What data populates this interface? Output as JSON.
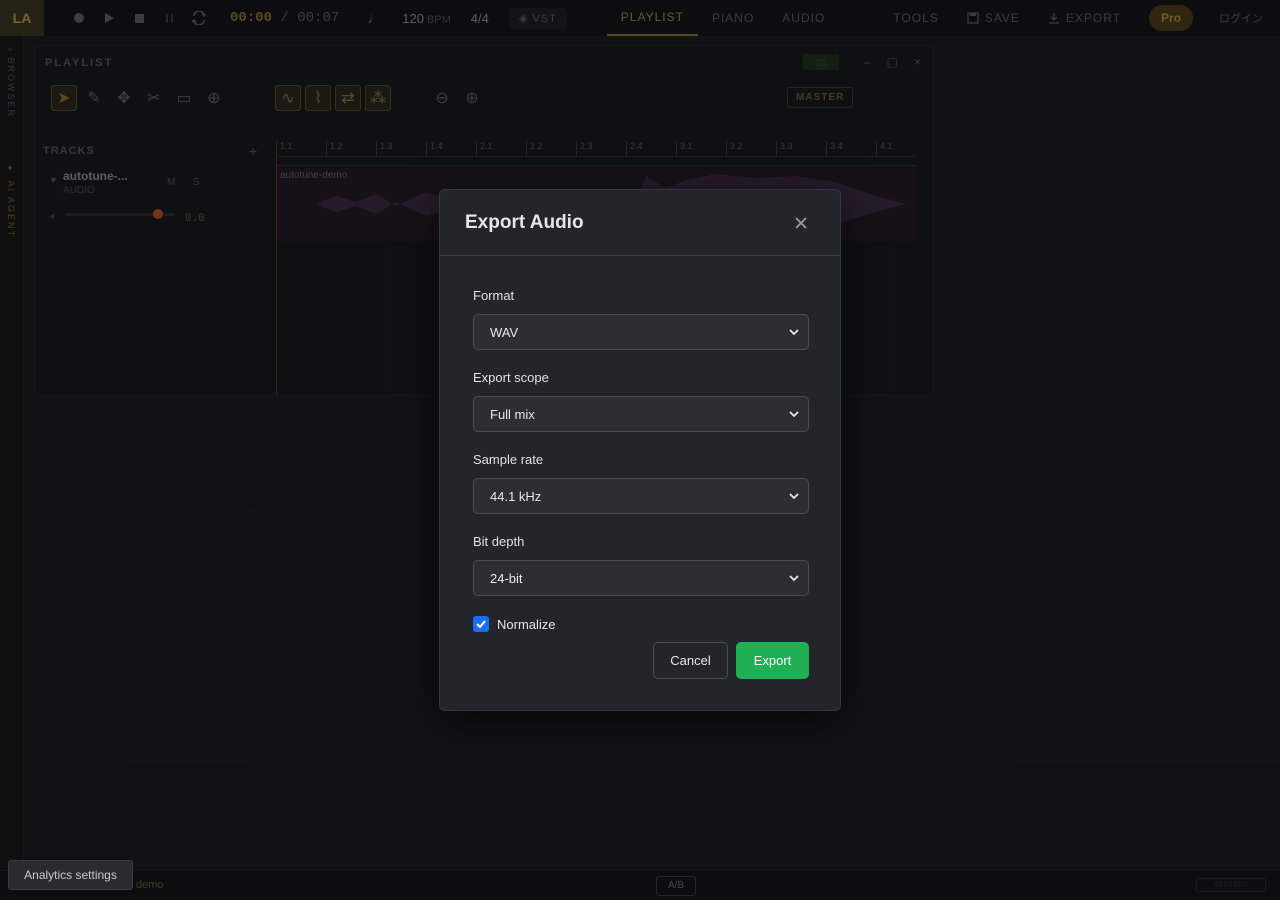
{
  "topbar": {
    "logo": "LA",
    "time_current": "00:00",
    "time_separator": "/",
    "time_total": "00:07",
    "bpm_value": "120",
    "bpm_unit": "BPM",
    "time_signature": "4/4",
    "vst_label": "VST",
    "tabs": [
      {
        "label": "PLAYLIST",
        "active": true
      },
      {
        "label": "PIANO",
        "active": false
      },
      {
        "label": "AUDIO",
        "active": false
      }
    ],
    "tools_label": "TOOLS",
    "save_label": "SAVE",
    "export_label": "EXPORT",
    "pro_label": "Pro",
    "login_label": "ログイン"
  },
  "rail": {
    "browser_label": "BROWSER",
    "agent_label": "AI AGENT"
  },
  "playlist": {
    "title": "PLAYLIST",
    "master_label": "MASTER",
    "tracks_header": "TRACKS",
    "add_label": "+",
    "track": {
      "name": "autotune-...",
      "type": "AUDIO",
      "mute": "M",
      "solo": "S",
      "gain": "0.0"
    },
    "ruler_ticks": [
      "1.1",
      "1.2",
      "1.3",
      "1.4",
      "2.1",
      "2.2",
      "2.3",
      "2.4",
      "3.1",
      "3.2",
      "3.3",
      "3.4",
      "4.1"
    ],
    "clip_label": "autotune-demo"
  },
  "modal": {
    "title": "Export Audio",
    "fields": [
      {
        "label": "Format",
        "value": "WAV"
      },
      {
        "label": "Export scope",
        "value": "Full mix"
      },
      {
        "label": "Sample rate",
        "value": "44.1 kHz"
      },
      {
        "label": "Bit depth",
        "value": "24-bit"
      }
    ],
    "normalize_label": "Normalize",
    "normalize_checked": true,
    "cancel_label": "Cancel",
    "export_label": "Export",
    "accent_color": "#1fb054",
    "checkbox_color": "#1a6ef5"
  },
  "statusbar": {
    "analytics_label": "Analytics settings",
    "project_name": "demo",
    "ab_label": "A/B"
  }
}
